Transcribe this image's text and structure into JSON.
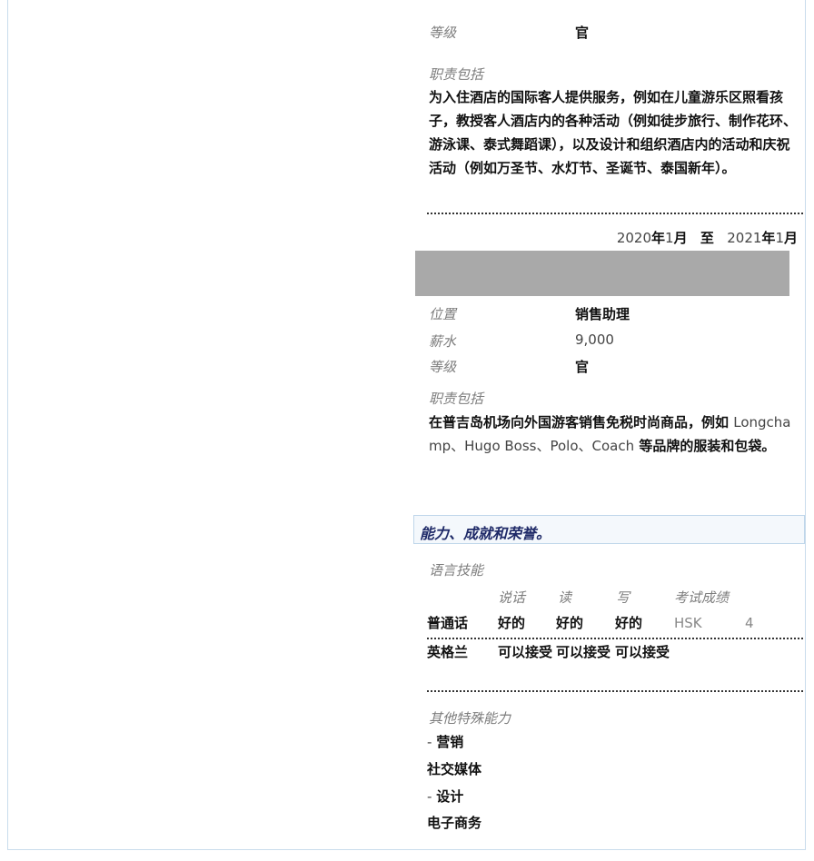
{
  "job1": {
    "grade_label": "等级",
    "grade_value": "官",
    "duties_label": "职责包括",
    "duties_text": "为入住酒店的国际客人提供服务，例如在儿童游乐区照看孩子，教授客人酒店内的各种活动（例如徒步旅行、制作花环、游泳课、泰式舞蹈课），以及设计和组织酒店内的活动和庆祝活动（例如万圣节、水灯节、圣诞节、泰国新年）。"
  },
  "job2": {
    "date_start_year": "2020",
    "date_year_char": "年",
    "date_start_month": "1",
    "date_month_char": "月",
    "date_to": "至",
    "date_end_year": "2021",
    "date_end_month": "1",
    "position_label": "位置",
    "position_value": "销售助理",
    "salary_label": "薪水",
    "salary_value": "9,000",
    "grade_label": "等级",
    "grade_value": "官",
    "duties_label": "职责包括",
    "duties_text_a": "在普吉岛机场向外国游客销售免税时尚商品，例如 ",
    "duties_text_b": "Longchamp、Hugo Boss、Polo、Coach",
    "duties_text_c": " 等品牌的服装和包袋。"
  },
  "skills": {
    "section_title": "能力、成就和荣誉。",
    "languages_label": "语言技能",
    "headers": [
      "说话",
      "读",
      "写",
      "考试成绩"
    ],
    "rows": [
      {
        "language": "普通话",
        "speak": "好的",
        "read": "好的",
        "write": "好的",
        "test": "HSK",
        "score": "4"
      },
      {
        "language": "英格兰",
        "speak": "可以接受",
        "read": "可以接受",
        "write": "可以接受"
      }
    ],
    "other_label": "其他特殊能力",
    "other_items": [
      "- 营销",
      "社交媒体",
      "- 设计",
      "电子商务"
    ]
  }
}
